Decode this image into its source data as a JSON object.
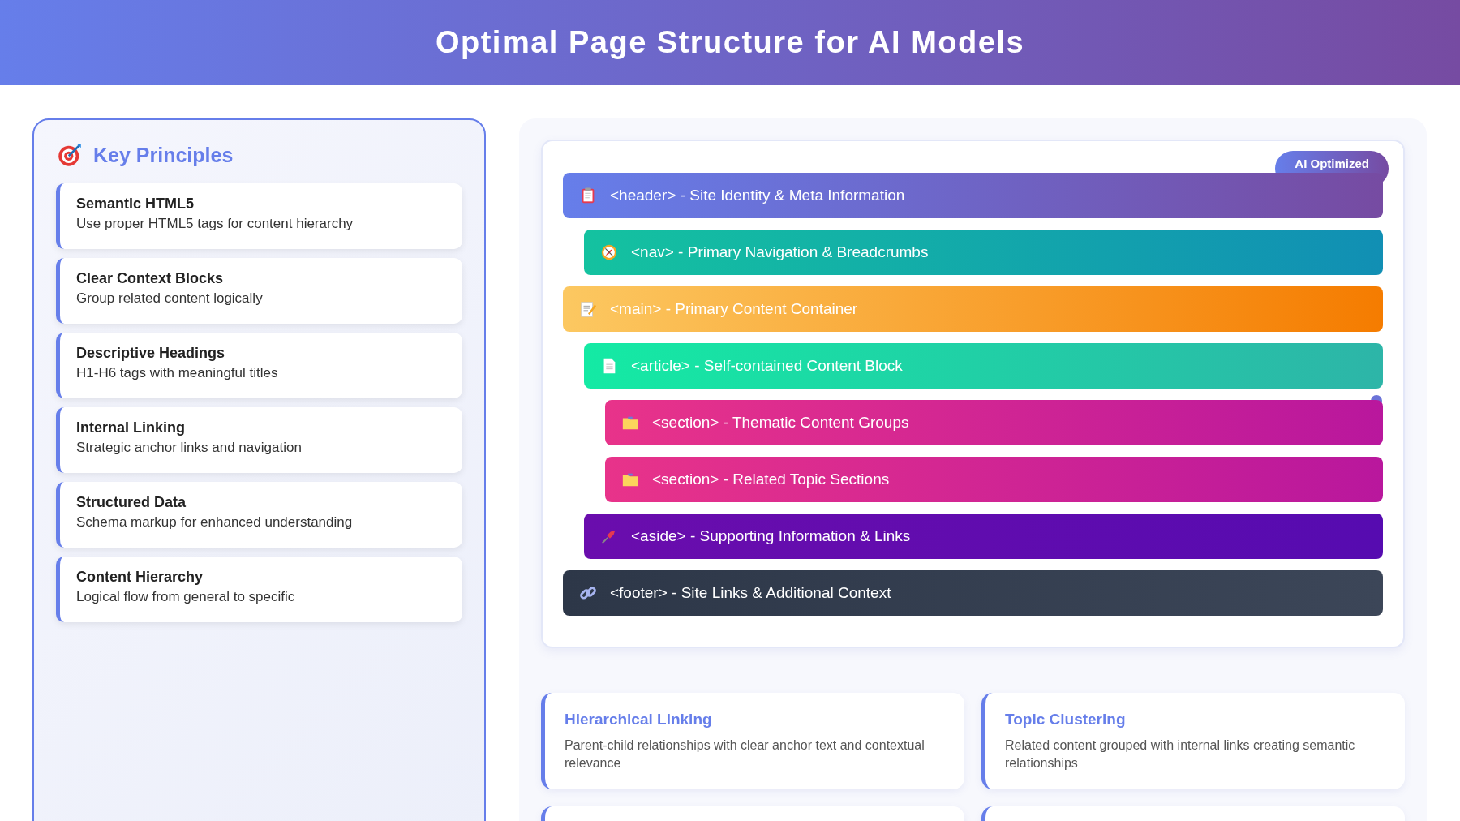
{
  "title": "Optimal Page Structure for AI Models",
  "sidebar": {
    "heading": "Key Principles",
    "items": [
      {
        "title": "Semantic HTML5",
        "description": "Use proper HTML5 tags for content hierarchy"
      },
      {
        "title": "Clear Context Blocks",
        "description": "Group related content logically"
      },
      {
        "title": "Descriptive Headings",
        "description": "H1-H6 tags with meaningful titles"
      },
      {
        "title": "Internal Linking",
        "description": "Strategic anchor links and navigation"
      },
      {
        "title": "Structured Data",
        "description": "Schema markup for enhanced understanding"
      },
      {
        "title": "Content Hierarchy",
        "description": "Logical flow from general to specific"
      }
    ]
  },
  "structure": {
    "badge": "AI Optimized",
    "blocks": [
      {
        "kind": "header",
        "label": "<header> - Site Identity & Meta Information",
        "children": [
          {
            "kind": "nav",
            "label": "<nav> - Primary Navigation & Breadcrumbs"
          }
        ]
      },
      {
        "kind": "main",
        "label": "<main> - Primary Content Container",
        "children": [
          {
            "kind": "article",
            "label": "<article> - Self-contained Content Block",
            "children": [
              {
                "kind": "section",
                "label": "<section> - Thematic Content Groups"
              },
              {
                "kind": "section",
                "label": "<section> - Related Topic Sections"
              }
            ]
          },
          {
            "kind": "aside",
            "label": "<aside> - Supporting Information & Links"
          }
        ]
      },
      {
        "kind": "footer",
        "label": "<footer> - Site Links & Additional Context"
      }
    ]
  },
  "cards": [
    {
      "kind": "card",
      "title": "Hierarchical Linking",
      "text": "Parent-child relationships with clear anchor text and contextual relevance"
    },
    {
      "kind": "card",
      "title": "Topic Clustering",
      "text": "Related content grouped with internal links creating semantic relationships"
    },
    {
      "kind": "card"
    },
    {
      "kind": "card"
    }
  ]
}
